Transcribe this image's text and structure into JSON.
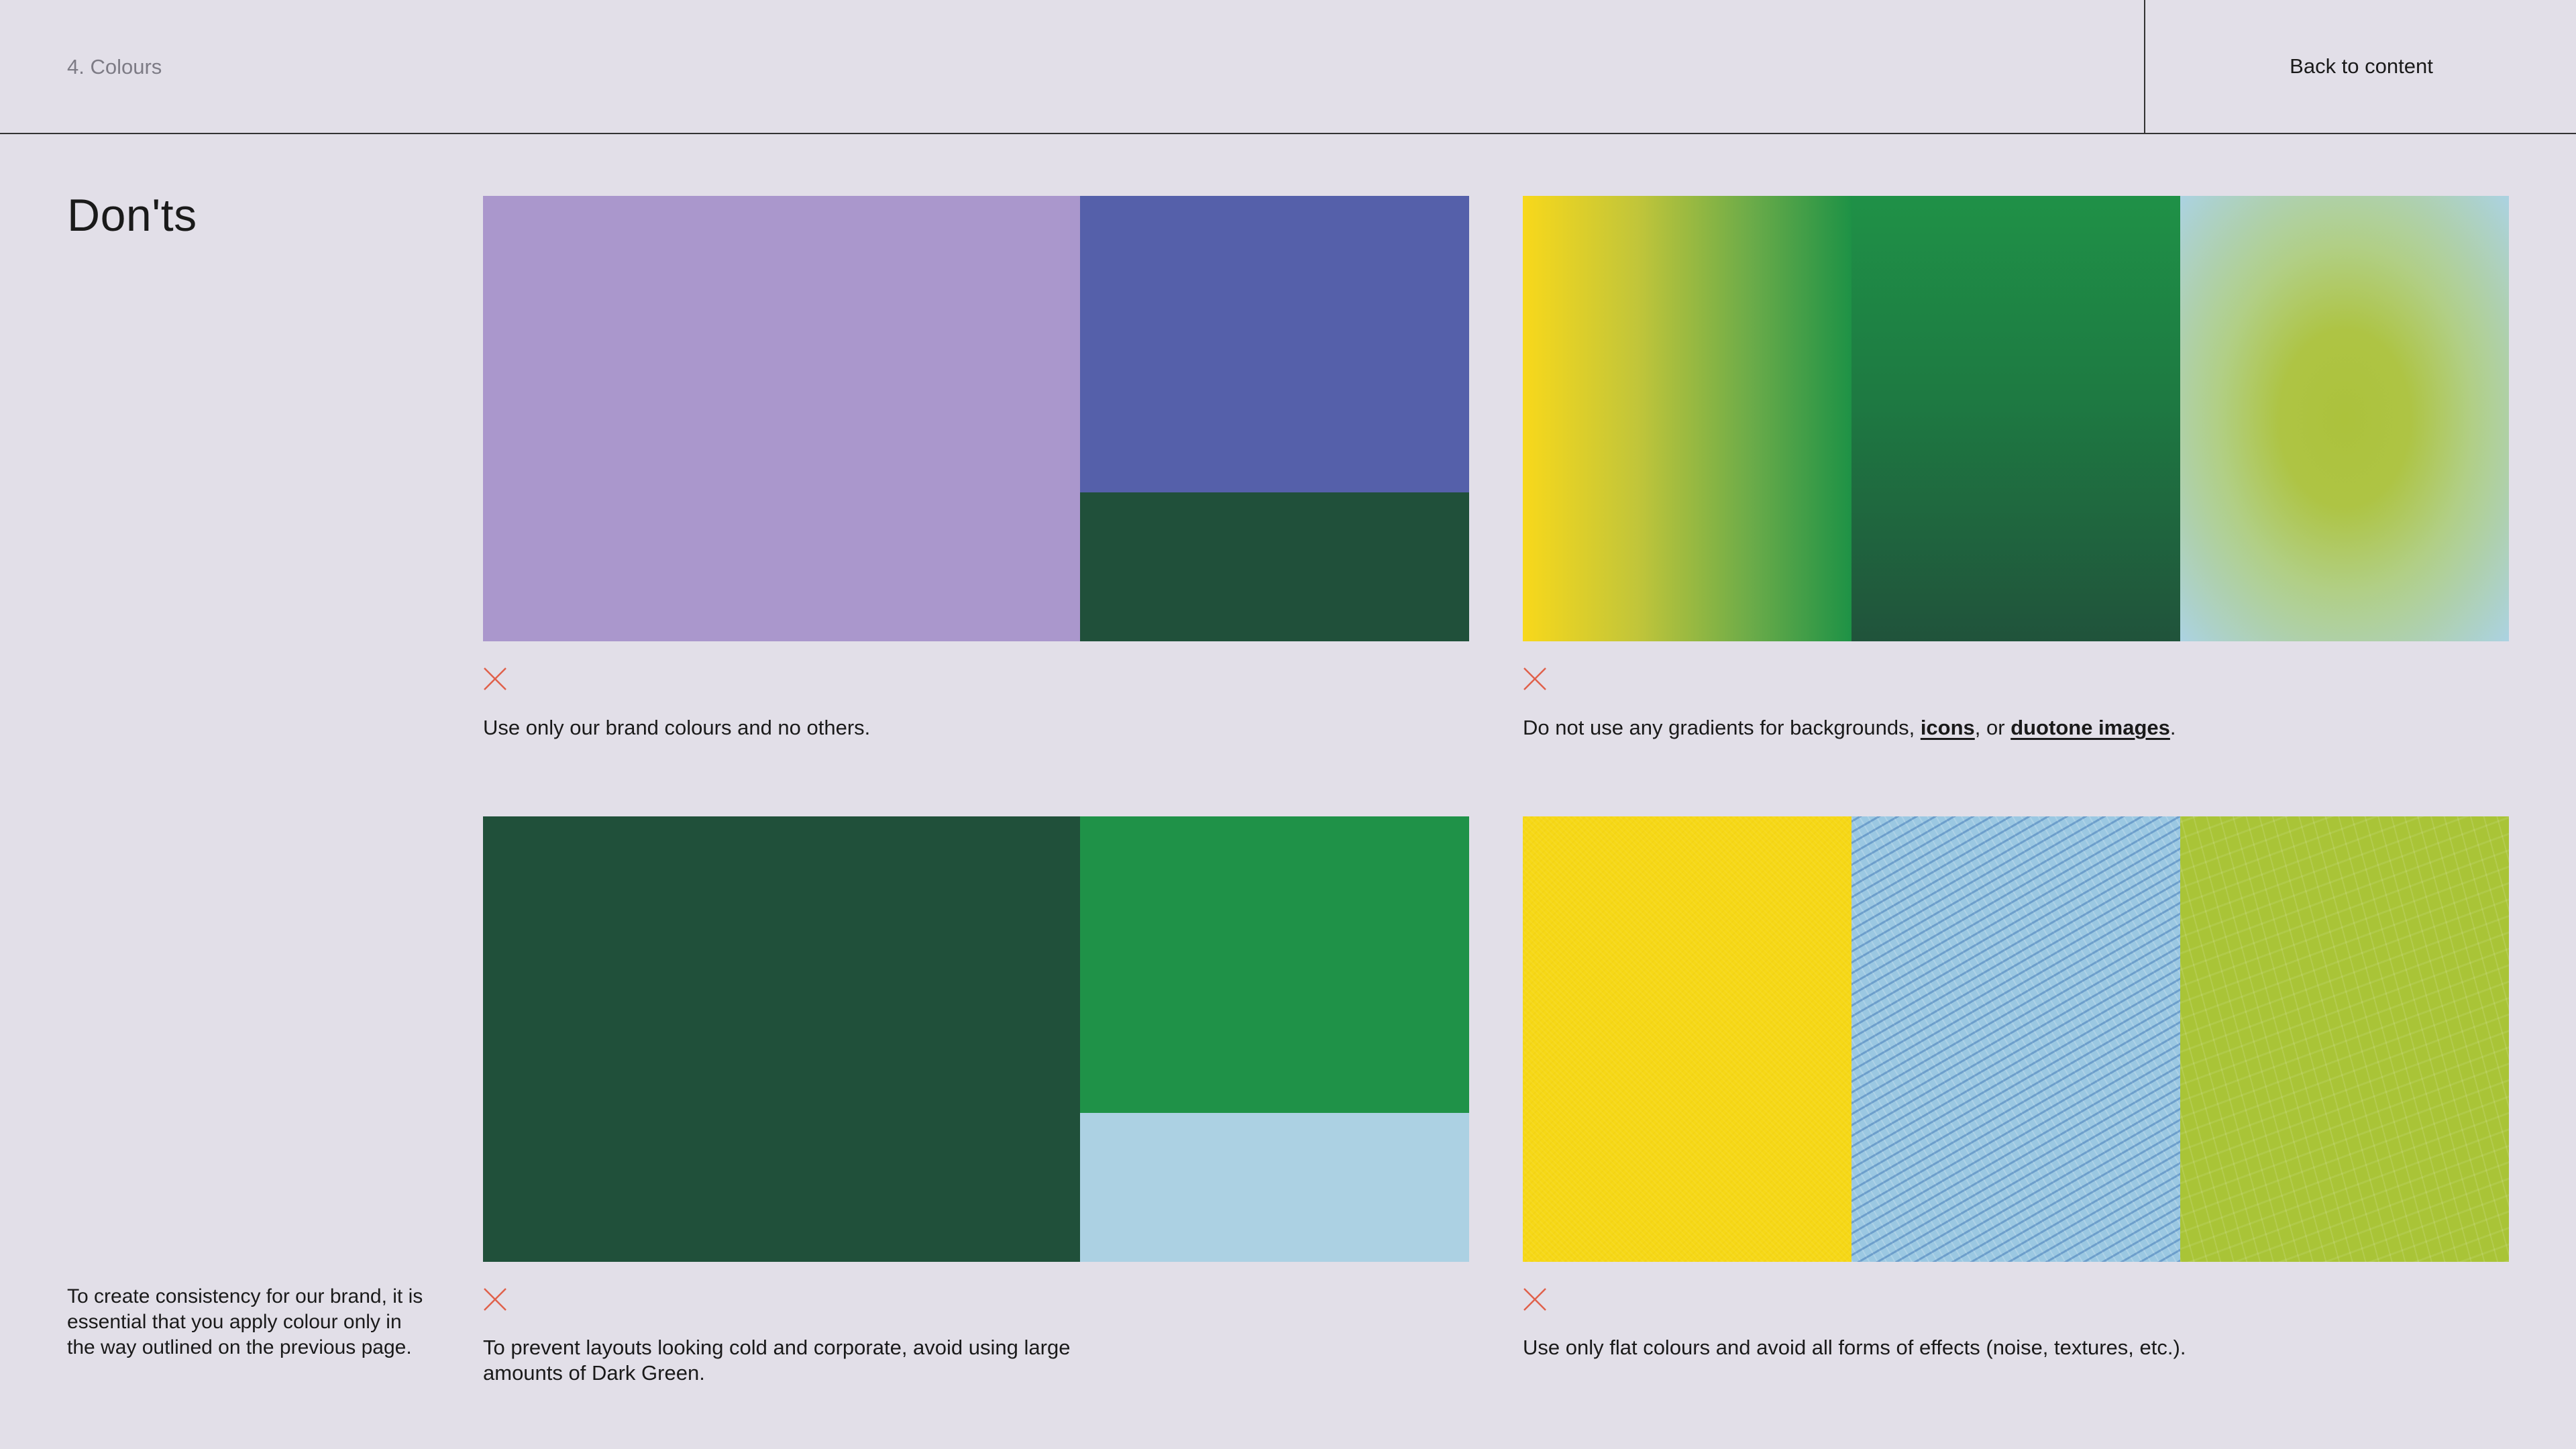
{
  "header": {
    "section_label": "4. Colours",
    "back_link": "Back to content"
  },
  "page": {
    "title": "Don'ts",
    "intro": "To create consistency for our brand, it is essential that you apply colour only in the way outlined on the previous page."
  },
  "colors": {
    "background": "#e2dfe8",
    "lavender": "#aa97cc",
    "indigo": "#5560aa",
    "dark_green": "#20503a",
    "green": "#1f9248",
    "light_blue": "#acd1e3",
    "yellow": "#f6d816",
    "lime": "#a9c437",
    "cross_red": "#e0604a"
  },
  "donts": [
    {
      "caption": "Use only our brand colours and no others.",
      "icon": "cross-icon"
    },
    {
      "caption_prefix": "Do not use any gradients for backgrounds, ",
      "link_icons": "icons",
      "caption_mid": ", or ",
      "link_duotone": "duotone images",
      "caption_suffix": ".",
      "icon": "cross-icon"
    },
    {
      "caption": "To prevent layouts looking cold and corporate, avoid using large amounts of Dark Green.",
      "icon": "cross-icon"
    },
    {
      "caption": "Use only flat colours and avoid all forms of effects (noise, textures, etc.).",
      "icon": "cross-icon"
    }
  ]
}
